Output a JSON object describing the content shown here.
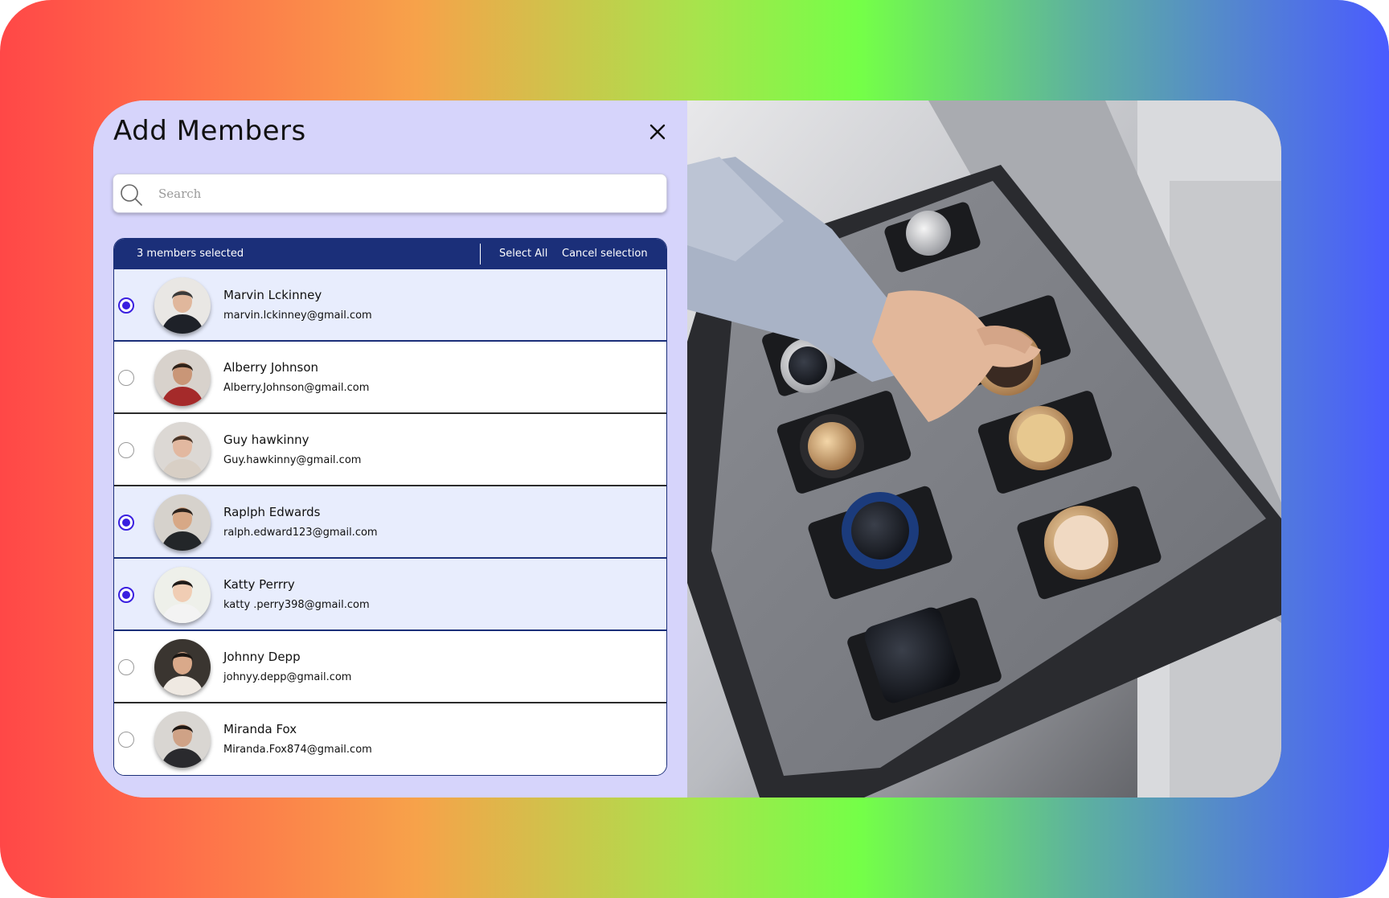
{
  "dialog": {
    "title": "Add Members",
    "close_icon": "close-icon"
  },
  "search": {
    "placeholder": "Search",
    "value": "",
    "icon": "search-icon"
  },
  "selection_bar": {
    "count_label": "3 members selected",
    "select_all_label": "Select All",
    "cancel_label": "Cancel selection"
  },
  "members": [
    {
      "name": "Marvin Lckinney",
      "email": "marvin.lckinney@gmail.com",
      "selected": true
    },
    {
      "name": "Alberry Johnson",
      "email": "Alberry.Johnson@gmail.com",
      "selected": false
    },
    {
      "name": "Guy hawkinny",
      "email": "Guy.hawkinny@gmail.com",
      "selected": false
    },
    {
      "name": "Raplph Edwards",
      "email": "ralph.edward123@gmail.com",
      "selected": true
    },
    {
      "name": "Katty Perrry",
      "email": "katty .perry398@gmail.com",
      "selected": true
    },
    {
      "name": "Johnny Depp",
      "email": "johnyy.depp@gmail.com",
      "selected": false
    },
    {
      "name": "Miranda Fox",
      "email": "Miranda.Fox874@gmail.com",
      "selected": false
    }
  ],
  "colors": {
    "panel_bg": "#d6d4fb",
    "header_bg": "#1b2f79",
    "selected_row_bg": "#e8edfd",
    "radio_accent": "#3a1fe0"
  }
}
